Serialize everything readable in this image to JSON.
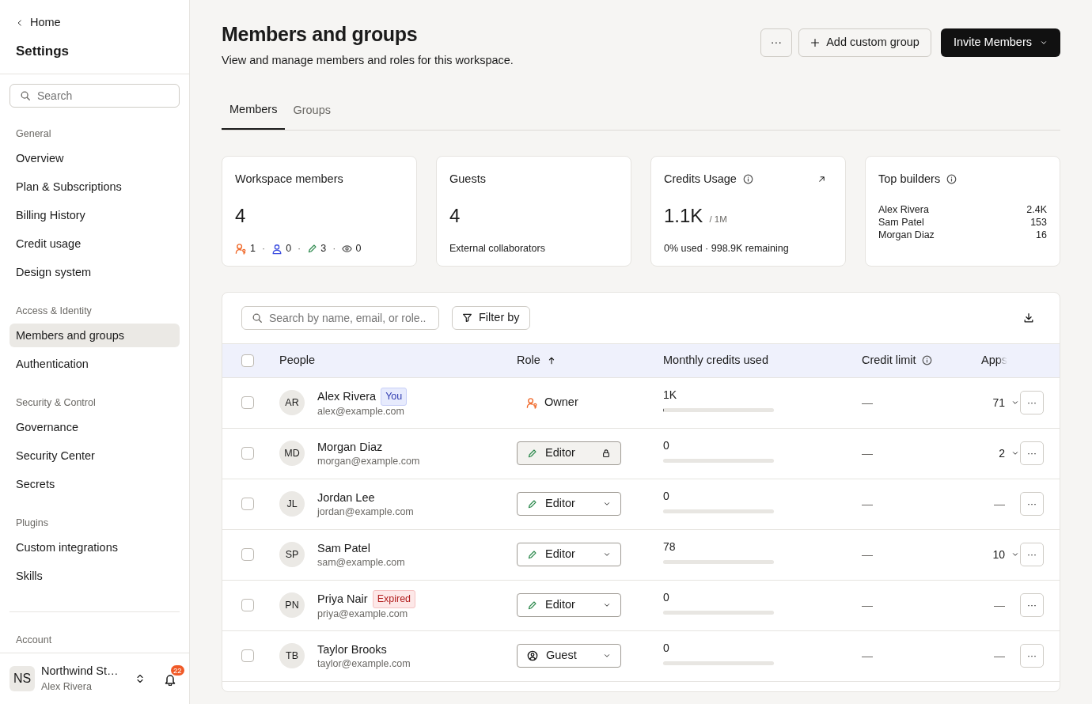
{
  "sidebar": {
    "back": "Home",
    "title": "Settings",
    "search": {
      "placeholder": "Search"
    },
    "sections": [
      {
        "heading": "General",
        "items": [
          {
            "label": "Overview",
            "selected": false
          },
          {
            "label": "Plan & Subscriptions",
            "selected": false
          },
          {
            "label": "Billing History",
            "selected": false
          },
          {
            "label": "Credit usage",
            "selected": false
          },
          {
            "label": "Design system",
            "selected": false
          }
        ]
      },
      {
        "heading": "Access & Identity",
        "items": [
          {
            "label": "Members and groups",
            "selected": true
          },
          {
            "label": "Authentication",
            "selected": false
          }
        ]
      },
      {
        "heading": "Security & Control",
        "items": [
          {
            "label": "Governance",
            "selected": false
          },
          {
            "label": "Security Center",
            "selected": false
          },
          {
            "label": "Secrets",
            "selected": false
          }
        ]
      },
      {
        "heading": "Plugins",
        "items": [
          {
            "label": "Custom integrations",
            "selected": false
          },
          {
            "label": "Skills",
            "selected": false
          }
        ]
      }
    ],
    "account_heading": "Account",
    "account": {
      "initials": "NS",
      "name": "Northwind St…",
      "user": "Alex Rivera",
      "notifications": "22"
    }
  },
  "header": {
    "title": "Members and groups",
    "subtitle": "View and manage members and roles for this workspace.",
    "more": "···",
    "add_group": "Add custom group",
    "invite": "Invite Members"
  },
  "tabs": [
    {
      "label": "Members",
      "selected": true
    },
    {
      "label": "Groups",
      "selected": false
    }
  ],
  "stats": [
    {
      "kind": "members",
      "title": "Workspace members",
      "value": "4",
      "separator": "·",
      "counts": [
        {
          "kind": "owner",
          "count": "1"
        },
        {
          "kind": "admin",
          "count": "0"
        },
        {
          "kind": "editor",
          "count": "3"
        },
        {
          "kind": "viewer",
          "count": "0"
        }
      ]
    },
    {
      "kind": "guests",
      "title": "Guests",
      "value": "4",
      "note": "External collaborators"
    },
    {
      "kind": "credits",
      "title": "Credits Usage",
      "value": "1.1K",
      "unit": "/ 1M",
      "note": "0% used · 998.9K remaining"
    },
    {
      "kind": "builders",
      "title": "Top builders",
      "builders": [
        {
          "name": "Alex Rivera",
          "value": "2.4K"
        },
        {
          "name": "Sam Patel",
          "value": "153"
        },
        {
          "name": "Morgan Diaz",
          "value": "16"
        }
      ]
    }
  ],
  "table": {
    "search": {
      "placeholder": "Search by name, email, or role.."
    },
    "filter": "Filter by",
    "all_checked": false,
    "columns": [
      "People",
      "Role",
      "Monthly credits used",
      "Credit limit",
      "Apps"
    ],
    "rows": [
      {
        "initials": "AR",
        "name": "Alex Rivera",
        "badge": {
          "kind": "you",
          "label": "You"
        },
        "email": "alex@example.com",
        "role": {
          "kind": "owner",
          "label": "Owner",
          "select": false
        },
        "credits": "1K",
        "level": 0.01,
        "limit": "—",
        "apps": {
          "text": "71",
          "expandable": true
        },
        "checked": false,
        "menu": "···"
      },
      {
        "initials": "MD",
        "name": "Morgan Diaz",
        "email": "morgan@example.com",
        "role": {
          "kind": "editor",
          "label": "Editor",
          "select": true,
          "locked": true
        },
        "credits": "0",
        "level": 0,
        "limit": "—",
        "apps": {
          "text": "2",
          "expandable": true
        },
        "checked": false,
        "menu": "···"
      },
      {
        "initials": "JL",
        "name": "Jordan Lee",
        "email": "jordan@example.com",
        "role": {
          "kind": "editor",
          "label": "Editor",
          "select": true,
          "locked": false
        },
        "credits": "0",
        "level": 0,
        "limit": "—",
        "apps": {
          "text": "—",
          "expandable": false
        },
        "checked": false,
        "menu": "···"
      },
      {
        "initials": "SP",
        "name": "Sam Patel",
        "email": "sam@example.com",
        "role": {
          "kind": "editor",
          "label": "Editor",
          "select": true,
          "locked": false
        },
        "credits": "78",
        "level": 0,
        "limit": "—",
        "apps": {
          "text": "10",
          "expandable": true
        },
        "checked": false,
        "menu": "···"
      },
      {
        "initials": "PN",
        "name": "Priya Nair",
        "badge": {
          "kind": "expired",
          "label": "Expired"
        },
        "email": "priya@example.com",
        "role": {
          "kind": "editor",
          "label": "Editor",
          "select": true,
          "locked": false
        },
        "credits": "0",
        "level": 0,
        "limit": "—",
        "apps": {
          "text": "—",
          "expandable": false
        },
        "checked": false,
        "menu": "···"
      },
      {
        "initials": "TB",
        "name": "Taylor Brooks",
        "email": "taylor@example.com",
        "role": {
          "kind": "guest",
          "label": "Guest",
          "select": true,
          "locked": false
        },
        "credits": "0",
        "level": 0,
        "limit": "—",
        "apps": {
          "text": "—",
          "expandable": false
        },
        "checked": false,
        "menu": "···"
      }
    ]
  }
}
